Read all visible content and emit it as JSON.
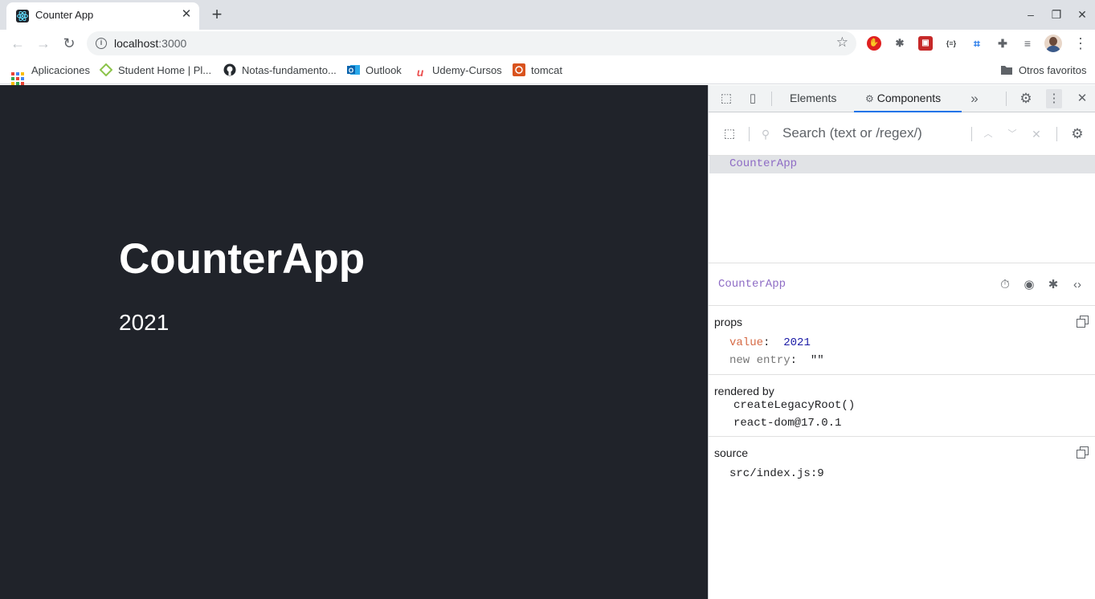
{
  "browser": {
    "tab_title": "Counter App",
    "tab_close": "✕",
    "new_tab": "+",
    "address": {
      "host": "localhost",
      "port": ":3000"
    },
    "window_controls": [
      "–",
      "❐",
      "✕"
    ]
  },
  "bookmarks": [
    {
      "label": "Aplicaciones",
      "icon": "apps-grid-icon"
    },
    {
      "label": "Student Home | Pl...",
      "icon": "student-home-icon"
    },
    {
      "label": "Notas-fundamento...",
      "icon": "github-icon"
    },
    {
      "label": "Outlook",
      "icon": "outlook-icon"
    },
    {
      "label": "Udemy-Cursos",
      "icon": "udemy-icon"
    },
    {
      "label": "tomcat",
      "icon": "tomcat-icon"
    },
    {
      "label": "Otros favoritos",
      "icon": "folder-icon"
    }
  ],
  "page": {
    "heading": "CounterApp",
    "value": "2021",
    "background": "#20232a"
  },
  "devtools": {
    "tabs": [
      "Elements",
      "Components"
    ],
    "active_tab": "Components",
    "search_placeholder": "Search (text or /regex/)",
    "tree_selected": "CounterApp",
    "inspected_component": "CounterApp",
    "props_label": "props",
    "props": [
      {
        "key": "value",
        "value": "2021"
      },
      {
        "key": "new entry",
        "value": "\"\""
      }
    ],
    "rendered_by_label": "rendered by",
    "rendered_by": [
      "createLegacyRoot()",
      "react-dom@17.0.1"
    ],
    "source_label": "source",
    "source": "src/index.js:9",
    "accent_color": "#1a73e8",
    "component_color": "#8e6cc5"
  }
}
